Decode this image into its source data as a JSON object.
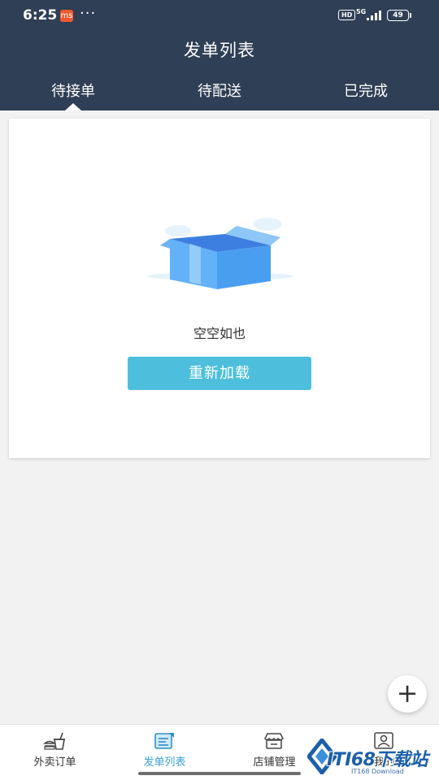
{
  "status_bar": {
    "time": "6:25",
    "app_badge_icon": "ms",
    "dots": "···",
    "hd": "HD",
    "network": "5G",
    "battery": "49"
  },
  "header": {
    "title": "发单列表",
    "background": "#2f3f55",
    "tabs": [
      {
        "label": "待接单",
        "active": true
      },
      {
        "label": "待配送",
        "active": false
      },
      {
        "label": "已完成",
        "active": false
      }
    ]
  },
  "content": {
    "empty_text": "空空如也",
    "reload_label": "重新加载",
    "reload_color": "#4dbfdc"
  },
  "fab": {
    "label": "+",
    "icon": "plus-icon"
  },
  "bottom_nav": {
    "items": [
      {
        "label": "外卖订单",
        "icon": "takeout-icon",
        "active": false
      },
      {
        "label": "发单列表",
        "icon": "dispatch-list-icon",
        "active": true
      },
      {
        "label": "店铺管理",
        "icon": "store-icon",
        "active": false
      },
      {
        "label": "我的",
        "icon": "profile-icon",
        "active": false
      }
    ],
    "active_color": "#3a9fd0"
  },
  "watermark": {
    "text": "ITI68下载站",
    "sub": "IT168 Download"
  }
}
